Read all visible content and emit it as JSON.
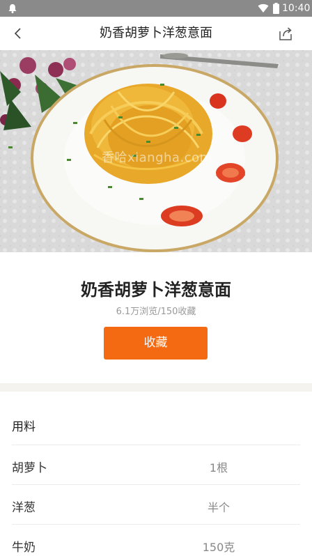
{
  "status_bar": {
    "time": "10:40",
    "icons": [
      "notification-icon",
      "wifi-icon",
      "battery-icon"
    ]
  },
  "nav": {
    "title": "奶香胡萝卜洋葱意面",
    "back_icon": "chevron-left-icon",
    "share_icon": "share-icon"
  },
  "hero": {
    "watermark": "香哈xiangha.com"
  },
  "recipe": {
    "name": "奶香胡萝卜洋葱意面",
    "stats": "6.1万浏览/150收藏",
    "collect_label": "收藏"
  },
  "ingredients": {
    "header": "用料",
    "items": [
      {
        "name": "胡萝卜",
        "qty": "1根"
      },
      {
        "name": "洋葱",
        "qty": "半个"
      },
      {
        "name": "牛奶",
        "qty": "150克"
      }
    ]
  },
  "colors": {
    "accent": "#f46a13",
    "status_bar": "#8a8a8a"
  }
}
